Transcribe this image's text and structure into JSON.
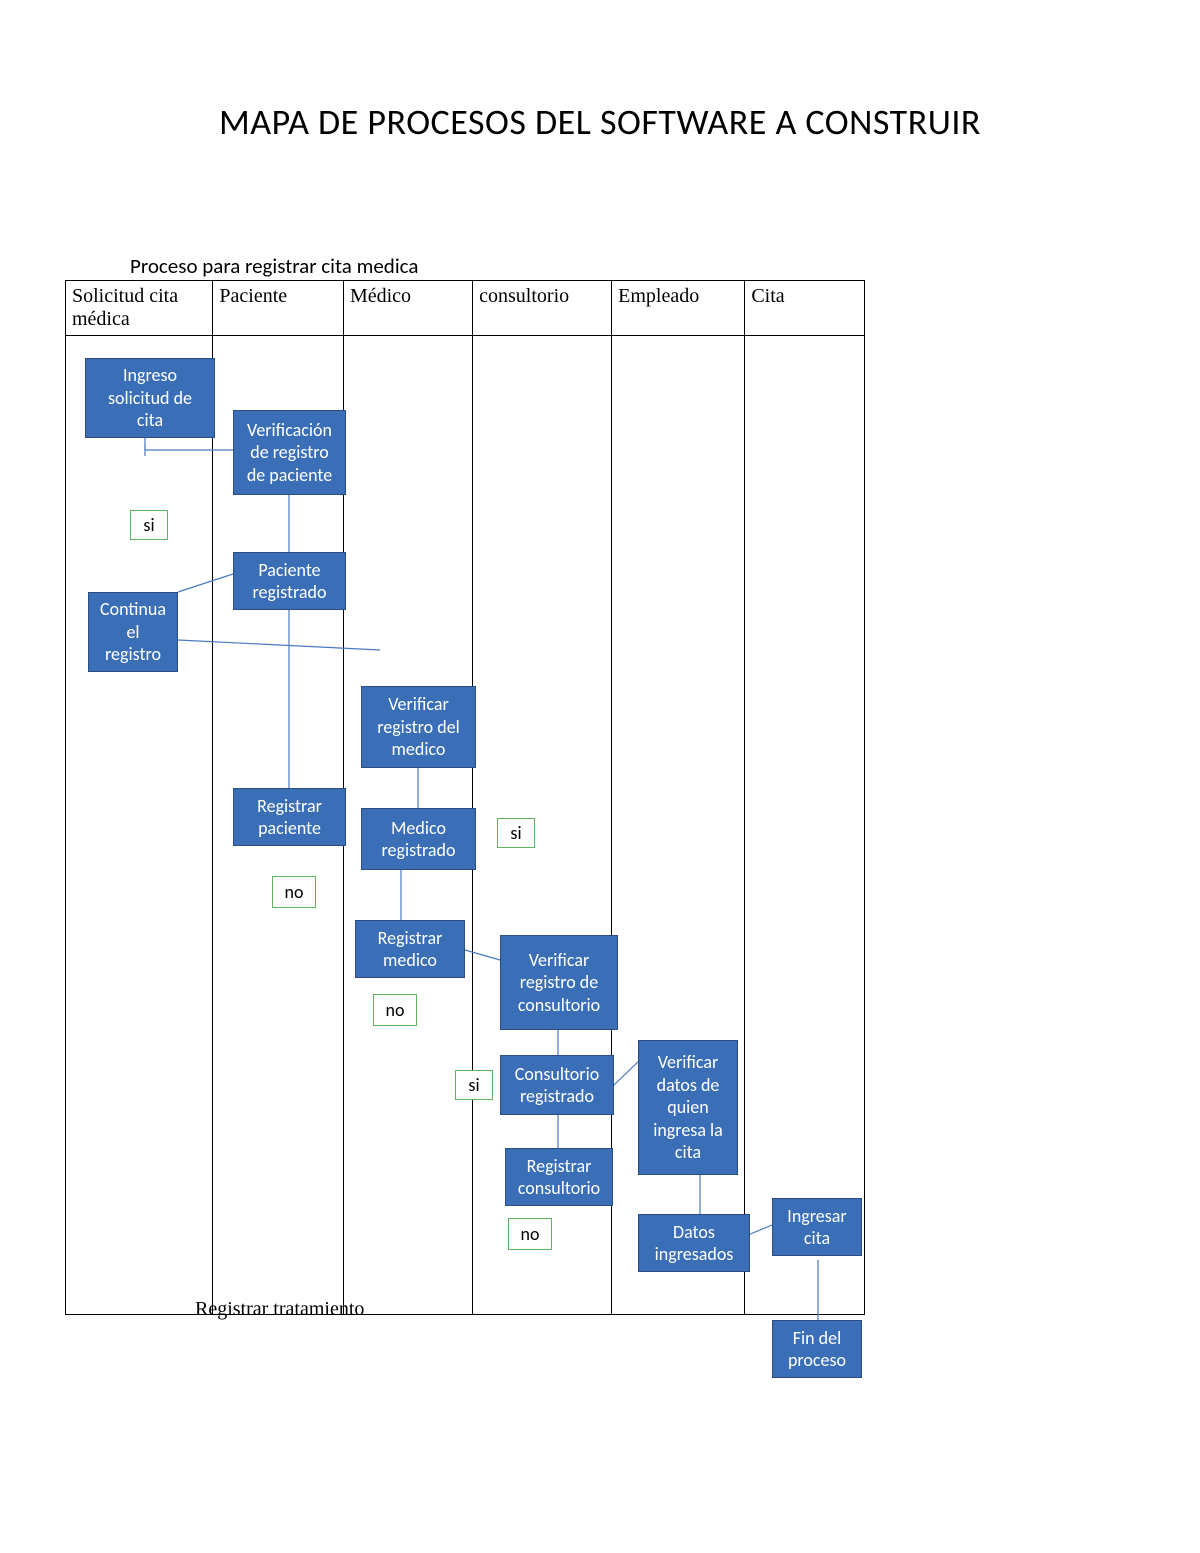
{
  "title": "MAPA DE PROCESOS DEL SOFTWARE A CONSTRUIR",
  "subtitle": "Proceso para registrar cita medica",
  "lanes": {
    "col0": "Solicitud cita médica",
    "col1": "Paciente",
    "col2": "Médico",
    "col3": "consultorio",
    "col4": "Empleado",
    "col5": "Cita"
  },
  "boxes": {
    "ingreso_solicitud": "Ingreso solicitud de cita",
    "verificacion_paciente": "Verificación de registro de paciente",
    "paciente_registrado": "Paciente registrado",
    "continua_registro": "Continua el registro",
    "registrar_paciente": "Registrar paciente",
    "verificar_medico": "Verificar registro del medico",
    "medico_registrado": "Medico registrado",
    "registrar_medico": "Registrar medico",
    "verificar_consultorio": "Verificar registro de consultorio",
    "consultorio_registrado": "Consultorio registrado",
    "registrar_consultorio": "Registrar consultorio",
    "verificar_datos_empleado": "Verificar datos de quien ingresa la cita",
    "datos_ingresados": "Datos ingresados",
    "ingresar_cita": "Ingresar cita",
    "fin_proceso": "Fin del proceso"
  },
  "labels": {
    "si": "si",
    "no": "no"
  },
  "footer": "Registrar tratamiento"
}
